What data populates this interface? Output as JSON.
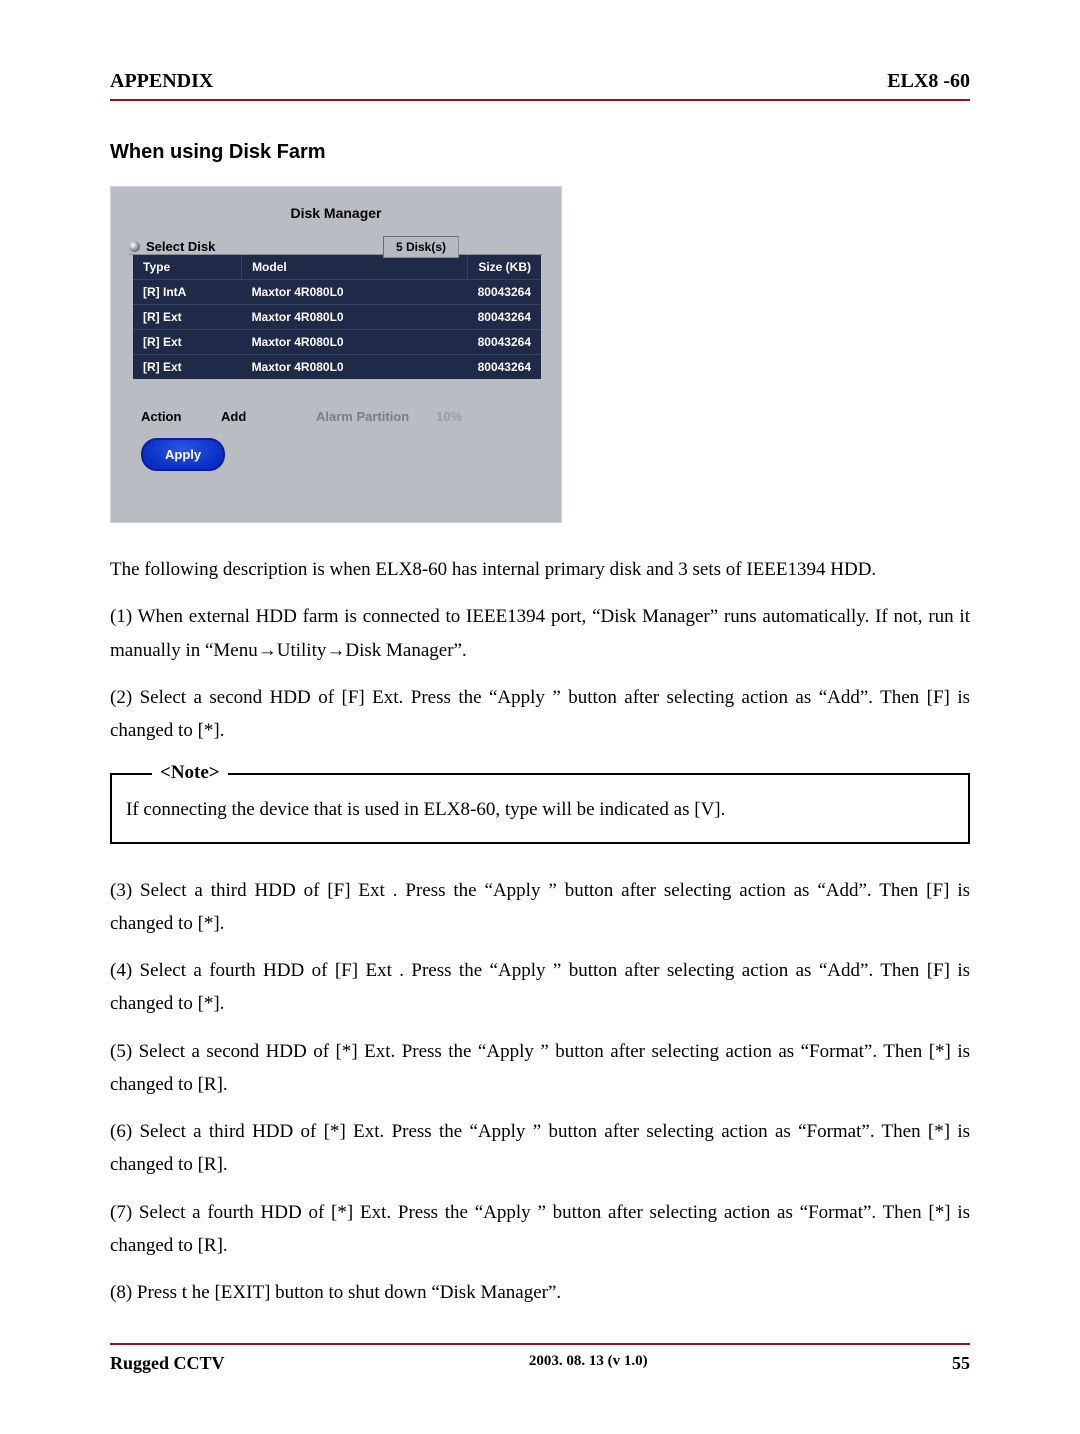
{
  "header": {
    "left": "APPENDIX",
    "right": "ELX8 -60"
  },
  "section_title": "When using Disk Farm",
  "disk_manager": {
    "title": "Disk Manager",
    "select_label": "Select Disk",
    "disk_count": "5 Disk(s)",
    "headers": {
      "type": "Type",
      "model": "Model",
      "size": "Size (KB)"
    },
    "rows": [
      {
        "type": "[R] IntA",
        "model": "Maxtor 4R080L0",
        "size": "80043264"
      },
      {
        "type": "[R] Ext",
        "model": "Maxtor 4R080L0",
        "size": "80043264"
      },
      {
        "type": "[R] Ext",
        "model": "Maxtor 4R080L0",
        "size": "80043264"
      },
      {
        "type": "[R] Ext",
        "model": "Maxtor 4R080L0",
        "size": "80043264"
      }
    ],
    "action_label": "Action",
    "action_value": "Add",
    "alarm_label": "Alarm Partition",
    "alarm_value": "10%",
    "apply_label": "Apply"
  },
  "paragraphs": {
    "intro": "The following description is when ELX8-60 has internal primary disk and 3 sets of IEEE1394 HDD.",
    "p1": "(1) When external HDD farm is connected to IEEE1394 port, “Disk Manager” runs automatically. If not, run it manually in “Menu→Utility→Disk Manager”.",
    "p2": "(2) Select a second HDD of [F] Ext. Press the “Apply ” button after selecting action as “Add”. Then [F] is changed to [*].",
    "p3": "(3) Select a third HDD of [F] Ext . Press the “Apply ” button after selecting action as “Add”. Then [F] is changed to [*].",
    "p4": "(4) Select a fourth HDD of [F] Ext . Press the “Apply ” button after selecting action as “Add”. Then [F] is changed to [*].",
    "p5": "(5) Select a second HDD of [*] Ext. Press the “Apply ” button after selecting action as “Format”. Then [*] is changed to [R].",
    "p6": "(6) Select a third HDD of [*] Ext. Press the “Apply ” button after selecting action as “Format”. Then [*] is changed to [R].",
    "p7": "(7) Select a fourth HDD of [*] Ext. Press the “Apply ” button after selecting action as “Format”. Then [*] is changed to [R].",
    "p8": "(8) Press t he [EXIT] button to shut down “Disk Manager”."
  },
  "note": {
    "legend": "<Note>",
    "text": "If connecting the device that is used in ELX8-60, type will be indicated as [V]."
  },
  "footer": {
    "left": "Rugged CCTV",
    "center": "2003. 08. 13 (v 1.0)",
    "right": "55"
  }
}
